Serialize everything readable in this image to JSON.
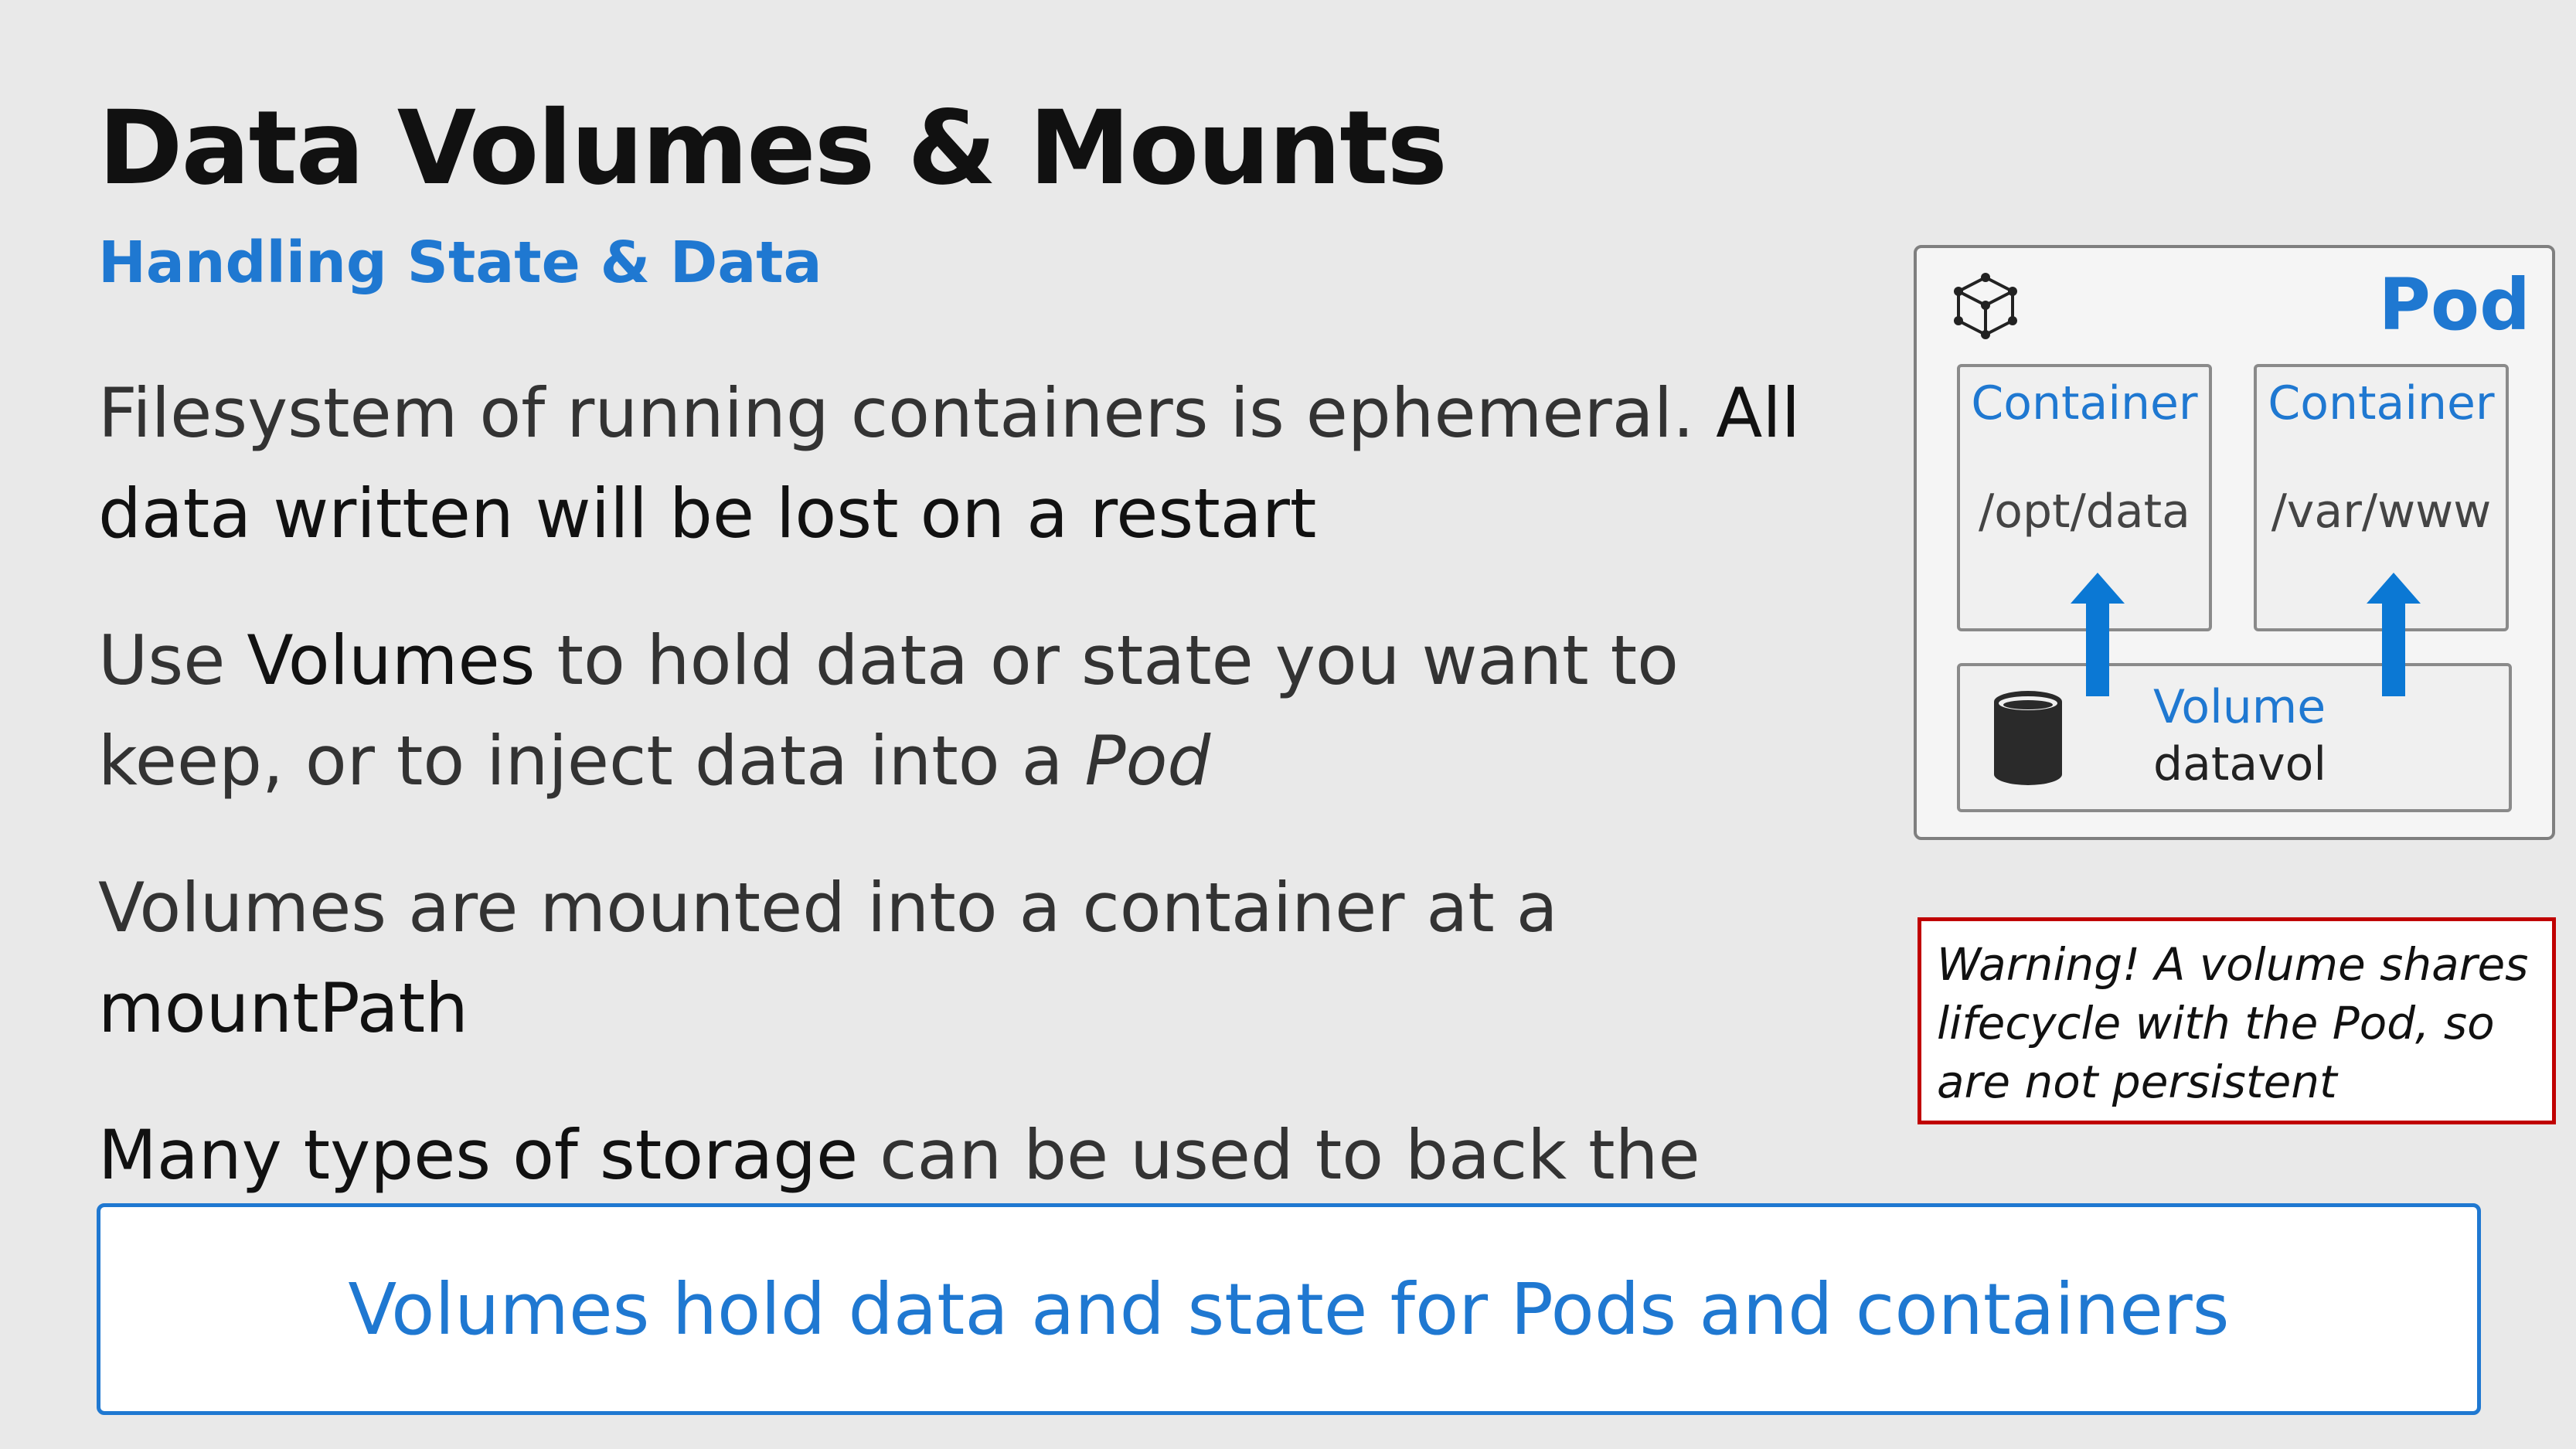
{
  "slide": {
    "title": "Data Volumes & Mounts",
    "subtitle": "Handling State & Data",
    "bullets": [
      {
        "plain1": "Filesystem of running containers is ephemeral. ",
        "strong": "All data written will be lost on a restart"
      },
      {
        "plain1": "Use ",
        "strong": "Volumes",
        "plain2": " to hold data or state you want to keep, or to inject data into a ",
        "italic": "Pod"
      },
      {
        "plain1": "Volumes are mounted into a container at a ",
        "strong": "mountPath"
      },
      {
        "strong": "Many types of storage",
        "plain2": " can be used to back the Volume"
      }
    ],
    "banner": "Volumes hold data and state for Pods and containers"
  },
  "diagram": {
    "pod_label": "Pod",
    "containers": [
      {
        "title": "Container",
        "path": "/opt/data"
      },
      {
        "title": "Container",
        "path": "/var/www"
      }
    ],
    "volume": {
      "title": "Volume",
      "name": "datavol"
    },
    "icons": {
      "pod": "cube-icon",
      "volume": "database-icon",
      "mount": "arrow-up-icon"
    }
  },
  "warning": "Warning! A volume shares lifecycle with the Pod, so are not persistent",
  "colors": {
    "accent": "#1f78d1",
    "warning_border": "#c00000",
    "background": "#e9e9e9"
  }
}
